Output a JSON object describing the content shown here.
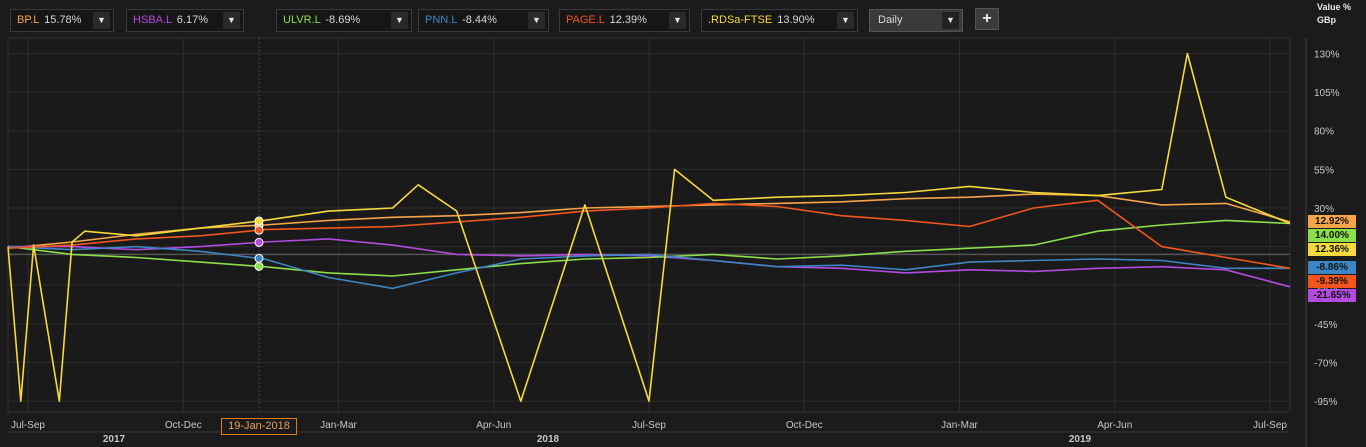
{
  "tickers": [
    {
      "symbol": "BP.L",
      "pct": "15.78%",
      "color": "#f7a54a"
    },
    {
      "symbol": "HSBA.L",
      "pct": "6.17%",
      "color": "#b24be0"
    },
    {
      "symbol": "ULVR.L",
      "pct": "-8.69%",
      "color": "#8be04a"
    },
    {
      "symbol": "PNN.L",
      "pct": "-8.44%",
      "color": "#3d86c6"
    },
    {
      "symbol": "PAGE.L",
      "pct": "12.39%",
      "color": "#f2561e"
    },
    {
      "symbol": ".RDSa-FTSE",
      "pct": "13.90%",
      "color": "#f5d93c"
    }
  ],
  "frequency": "Daily",
  "add_button": "+",
  "axis_title": {
    "line1": "Value %",
    "line2": "GBp"
  },
  "hover_date": "19-Jan-2018",
  "chart_data": {
    "type": "line",
    "x_tick_labels": [
      "Jul-Sep",
      "Oct-Dec",
      "Jan-Mar",
      "Apr-Jun",
      "Jul-Sep",
      "Oct-Dec",
      "Jan-Mar",
      "Apr-Jun",
      "Jul-Sep"
    ],
    "x_year_labels": [
      "2017",
      "2018",
      "2019"
    ],
    "x_range": [
      "2017-06",
      "2019-10"
    ],
    "y_tick_labels": [
      "130%",
      "105%",
      "80%",
      "55%",
      "30%",
      "5%",
      "-20%",
      "-45%",
      "-70%",
      "-95%"
    ],
    "y_ticks": [
      130,
      105,
      80,
      55,
      30,
      5,
      -20,
      -45,
      -70,
      -95
    ],
    "ylim": [
      -102,
      140
    ],
    "grid": true,
    "series": [
      {
        "name": "BP.L",
        "color": "#f7a54a",
        "last_label": "12.92%",
        "x": [
          0.0,
          0.05,
          0.1,
          0.15,
          0.2,
          0.25,
          0.3,
          0.35,
          0.4,
          0.45,
          0.5,
          0.55,
          0.6,
          0.65,
          0.7,
          0.75,
          0.8,
          0.85,
          0.9,
          0.95,
          1.0
        ],
        "y": [
          4,
          8,
          13,
          17,
          19,
          22,
          24,
          25,
          27,
          30,
          31,
          32,
          33,
          34,
          36,
          37,
          39,
          38,
          32,
          33,
          21
        ]
      },
      {
        "name": "HSBA.L",
        "color": "#b24be0",
        "last_label": "-21.65%",
        "x": [
          0.0,
          0.05,
          0.1,
          0.15,
          0.2,
          0.25,
          0.3,
          0.35,
          0.4,
          0.45,
          0.5,
          0.55,
          0.6,
          0.65,
          0.7,
          0.75,
          0.8,
          0.85,
          0.9,
          0.95,
          1.0
        ],
        "y": [
          5,
          5,
          3,
          5,
          8,
          10,
          6,
          0,
          -1,
          0,
          -1,
          -4,
          -8,
          -9,
          -12,
          -10,
          -11,
          -9,
          -8,
          -10,
          -21
        ]
      },
      {
        "name": "ULVR.L",
        "color": "#8be04a",
        "last_label": "14.00%",
        "x": [
          0.0,
          0.05,
          0.1,
          0.15,
          0.2,
          0.25,
          0.3,
          0.35,
          0.4,
          0.45,
          0.5,
          0.55,
          0.6,
          0.65,
          0.7,
          0.75,
          0.8,
          0.85,
          0.9,
          0.95,
          1.0
        ],
        "y": [
          5,
          0,
          -2,
          -5,
          -8,
          -12,
          -14,
          -10,
          -6,
          -3,
          -2,
          0,
          -3,
          -1,
          2,
          4,
          6,
          15,
          19,
          22,
          20
        ]
      },
      {
        "name": "PNN.L",
        "color": "#3d86c6",
        "last_label": "-8.86%",
        "x": [
          0.0,
          0.05,
          0.1,
          0.15,
          0.2,
          0.25,
          0.3,
          0.35,
          0.4,
          0.45,
          0.5,
          0.55,
          0.6,
          0.65,
          0.7,
          0.75,
          0.8,
          0.85,
          0.9,
          0.95,
          1.0
        ],
        "y": [
          5,
          3,
          5,
          2,
          -3,
          -15,
          -22,
          -12,
          -3,
          -1,
          0,
          -4,
          -8,
          -7,
          -10,
          -5,
          -4,
          -3,
          -4,
          -9,
          -9
        ]
      },
      {
        "name": "PAGE.L",
        "color": "#f2561e",
        "last_label": "-9.39%",
        "x": [
          0.0,
          0.05,
          0.1,
          0.15,
          0.2,
          0.25,
          0.3,
          0.35,
          0.4,
          0.45,
          0.5,
          0.55,
          0.6,
          0.65,
          0.7,
          0.75,
          0.8,
          0.85,
          0.9,
          0.95,
          1.0
        ],
        "y": [
          4,
          6,
          10,
          12,
          16,
          17,
          18,
          21,
          24,
          28,
          30,
          33,
          31,
          25,
          22,
          18,
          30,
          35,
          5,
          -2,
          -9
        ]
      },
      {
        "name": ".RDSa-FTSE",
        "color": "#f5d93c",
        "last_label": "12.36%",
        "x": [
          0.0,
          0.01,
          0.02,
          0.04,
          0.05,
          0.06,
          0.1,
          0.15,
          0.2,
          0.25,
          0.3,
          0.32,
          0.35,
          0.4,
          0.45,
          0.5,
          0.52,
          0.55,
          0.6,
          0.65,
          0.7,
          0.75,
          0.8,
          0.85,
          0.9,
          0.92,
          0.95,
          1.0
        ],
        "y": [
          5,
          -95,
          6,
          -95,
          8,
          15,
          12,
          17,
          22,
          28,
          30,
          45,
          28,
          -95,
          32,
          -95,
          55,
          35,
          37,
          38,
          40,
          44,
          40,
          38,
          42,
          130,
          37,
          20
        ]
      }
    ]
  }
}
